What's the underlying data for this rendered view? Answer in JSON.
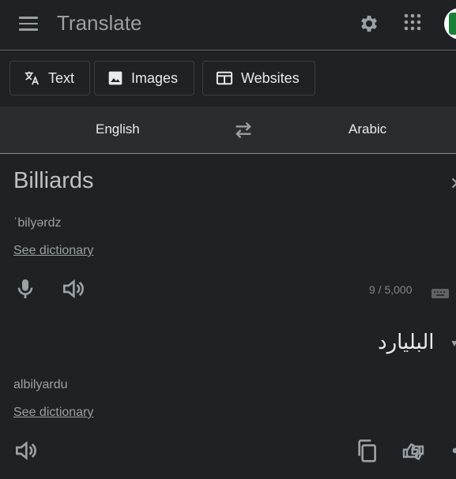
{
  "header": {
    "title": "Translate",
    "menu_icon": "hamburger-menu-icon",
    "settings_icon": "gear-icon",
    "apps_icon": "apps-grid-icon"
  },
  "modes": [
    {
      "label": "Text",
      "icon": "translate-icon"
    },
    {
      "label": "Images",
      "icon": "image-icon"
    },
    {
      "label": "Websites",
      "icon": "web-page-icon"
    }
  ],
  "languages": {
    "source": "English",
    "target": "Arabic",
    "swap_icon": "swap-arrows-icon"
  },
  "source": {
    "text": "Billiards",
    "phonetic": "ˈbilyərdz",
    "dictionary_link": "See dictionary",
    "char_count": "9 / 5,000"
  },
  "target": {
    "text": "البليارد",
    "transliteration": "albilyardu",
    "dictionary_link": "See dictionary"
  },
  "colors": {
    "background": "#202124",
    "lang_bar": "#2b2c2f",
    "text": "#e8eaed",
    "muted": "#9aa0a6",
    "border": "#3c4043"
  }
}
